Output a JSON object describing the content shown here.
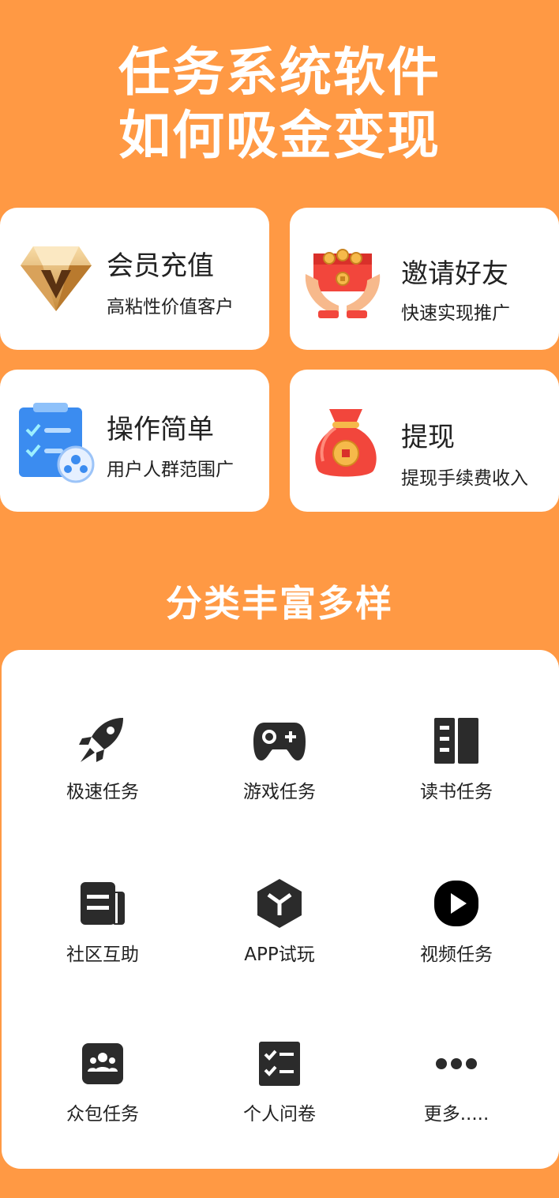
{
  "hero": {
    "line1": "任务系统软件",
    "line2": "如何吸金变现"
  },
  "features": [
    {
      "title": "会员充值",
      "subtitle": "高粘性价值客户",
      "icon": "diamond-icon"
    },
    {
      "title": "邀请好友",
      "subtitle": "快速实现推广",
      "icon": "gift-hands-icon"
    },
    {
      "title": "操作简单",
      "subtitle": "用户人群范围广",
      "icon": "clipboard-icon"
    },
    {
      "title": "提现",
      "subtitle": "提现手续费收入",
      "icon": "money-bag-icon"
    }
  ],
  "section": {
    "title": "分类丰富多样"
  },
  "categories": [
    {
      "label": "极速任务",
      "icon": "rocket-icon"
    },
    {
      "label": "游戏任务",
      "icon": "gamepad-icon"
    },
    {
      "label": "读书任务",
      "icon": "book-icon"
    },
    {
      "label": "社区互助",
      "icon": "newspaper-icon"
    },
    {
      "label": "APP试玩",
      "icon": "cube-icon"
    },
    {
      "label": "视频任务",
      "icon": "play-icon"
    },
    {
      "label": "众包任务",
      "icon": "group-icon"
    },
    {
      "label": "个人问卷",
      "icon": "checklist-icon"
    },
    {
      "label": "更多.....",
      "icon": "more-icon"
    }
  ],
  "colors": {
    "background": "#FF9944",
    "card": "#FFFFFF",
    "icon_dark": "#2B2B2B"
  }
}
